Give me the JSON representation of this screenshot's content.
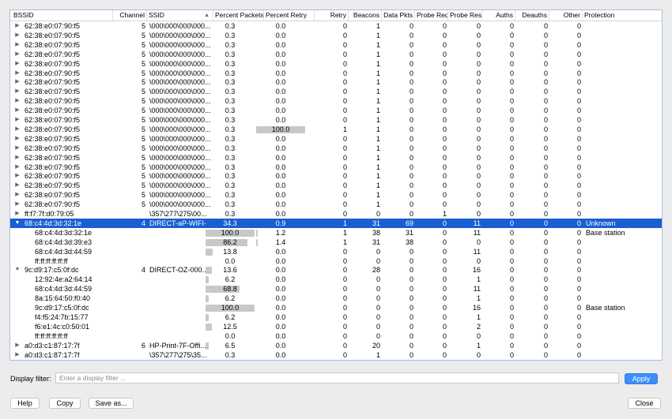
{
  "columns": [
    {
      "label": "BSSID"
    },
    {
      "label": "Channel"
    },
    {
      "label": "SSID"
    },
    {
      "label": "Percent Packets"
    },
    {
      "label": "Percent Retry"
    },
    {
      "label": "Retry"
    },
    {
      "label": "Beacons"
    },
    {
      "label": "Data Pkts"
    },
    {
      "label": "Probe Reqs"
    },
    {
      "label": "Probe Resp"
    },
    {
      "label": "Auths"
    },
    {
      "label": "Deauths"
    },
    {
      "label": "Other"
    },
    {
      "label": "Protection"
    }
  ],
  "sort_indicator": "▲",
  "rows": [
    {
      "level": 0,
      "expander": "closed",
      "bssid": "62:38:e0:07:90:f5",
      "channel": "5",
      "ssid": "\\000\\000\\000\\000...",
      "pct_packets": "0.3",
      "pct_packets_frac": 0,
      "pct_retry": "0.0",
      "pct_retry_frac": 0,
      "retry": "0",
      "beacons": "1",
      "data": "0",
      "probe_req": "0",
      "probe_resp": "0",
      "auths": "0",
      "deauths": "0",
      "other": "0",
      "protection": ""
    },
    {
      "level": 0,
      "expander": "closed",
      "bssid": "62:38:e0:07:90:f5",
      "channel": "5",
      "ssid": "\\000\\000\\000\\000...",
      "pct_packets": "0.3",
      "pct_packets_frac": 0,
      "pct_retry": "0.0",
      "pct_retry_frac": 0,
      "retry": "0",
      "beacons": "1",
      "data": "0",
      "probe_req": "0",
      "probe_resp": "0",
      "auths": "0",
      "deauths": "0",
      "other": "0",
      "protection": ""
    },
    {
      "level": 0,
      "expander": "closed",
      "bssid": "62:38:e0:07:90:f5",
      "channel": "5",
      "ssid": "\\000\\000\\000\\000...",
      "pct_packets": "0.3",
      "pct_packets_frac": 0,
      "pct_retry": "0.0",
      "pct_retry_frac": 0,
      "retry": "0",
      "beacons": "1",
      "data": "0",
      "probe_req": "0",
      "probe_resp": "0",
      "auths": "0",
      "deauths": "0",
      "other": "0",
      "protection": ""
    },
    {
      "level": 0,
      "expander": "closed",
      "bssid": "62:38:e0:07:90:f5",
      "channel": "5",
      "ssid": "\\000\\000\\000\\000...",
      "pct_packets": "0.3",
      "pct_packets_frac": 0,
      "pct_retry": "0.0",
      "pct_retry_frac": 0,
      "retry": "0",
      "beacons": "1",
      "data": "0",
      "probe_req": "0",
      "probe_resp": "0",
      "auths": "0",
      "deauths": "0",
      "other": "0",
      "protection": ""
    },
    {
      "level": 0,
      "expander": "closed",
      "bssid": "62:38:e0:07:90:f5",
      "channel": "5",
      "ssid": "\\000\\000\\000\\000...",
      "pct_packets": "0.3",
      "pct_packets_frac": 0,
      "pct_retry": "0.0",
      "pct_retry_frac": 0,
      "retry": "0",
      "beacons": "1",
      "data": "0",
      "probe_req": "0",
      "probe_resp": "0",
      "auths": "0",
      "deauths": "0",
      "other": "0",
      "protection": ""
    },
    {
      "level": 0,
      "expander": "closed",
      "bssid": "62:38:e0:07:90:f5",
      "channel": "5",
      "ssid": "\\000\\000\\000\\000...",
      "pct_packets": "0.3",
      "pct_packets_frac": 0,
      "pct_retry": "0.0",
      "pct_retry_frac": 0,
      "retry": "0",
      "beacons": "1",
      "data": "0",
      "probe_req": "0",
      "probe_resp": "0",
      "auths": "0",
      "deauths": "0",
      "other": "0",
      "protection": ""
    },
    {
      "level": 0,
      "expander": "closed",
      "bssid": "62:38:e0:07:90:f5",
      "channel": "5",
      "ssid": "\\000\\000\\000\\000...",
      "pct_packets": "0.3",
      "pct_packets_frac": 0,
      "pct_retry": "0.0",
      "pct_retry_frac": 0,
      "retry": "0",
      "beacons": "1",
      "data": "0",
      "probe_req": "0",
      "probe_resp": "0",
      "auths": "0",
      "deauths": "0",
      "other": "0",
      "protection": ""
    },
    {
      "level": 0,
      "expander": "closed",
      "bssid": "62:38:e0:07:90:f5",
      "channel": "5",
      "ssid": "\\000\\000\\000\\000...",
      "pct_packets": "0.3",
      "pct_packets_frac": 0,
      "pct_retry": "0.0",
      "pct_retry_frac": 0,
      "retry": "0",
      "beacons": "1",
      "data": "0",
      "probe_req": "0",
      "probe_resp": "0",
      "auths": "0",
      "deauths": "0",
      "other": "0",
      "protection": ""
    },
    {
      "level": 0,
      "expander": "closed",
      "bssid": "62:38:e0:07:90:f5",
      "channel": "5",
      "ssid": "\\000\\000\\000\\000...",
      "pct_packets": "0.3",
      "pct_packets_frac": 0,
      "pct_retry": "0.0",
      "pct_retry_frac": 0,
      "retry": "0",
      "beacons": "1",
      "data": "0",
      "probe_req": "0",
      "probe_resp": "0",
      "auths": "0",
      "deauths": "0",
      "other": "0",
      "protection": ""
    },
    {
      "level": 0,
      "expander": "closed",
      "bssid": "62:38:e0:07:90:f5",
      "channel": "5",
      "ssid": "\\000\\000\\000\\000...",
      "pct_packets": "0.3",
      "pct_packets_frac": 0,
      "pct_retry": "0.0",
      "pct_retry_frac": 0,
      "retry": "0",
      "beacons": "1",
      "data": "0",
      "probe_req": "0",
      "probe_resp": "0",
      "auths": "0",
      "deauths": "0",
      "other": "0",
      "protection": ""
    },
    {
      "level": 0,
      "expander": "closed",
      "bssid": "62:38:e0:07:90:f5",
      "channel": "5",
      "ssid": "\\000\\000\\000\\000...",
      "pct_packets": "0.3",
      "pct_packets_frac": 0,
      "pct_retry": "0.0",
      "pct_retry_frac": 0,
      "retry": "0",
      "beacons": "1",
      "data": "0",
      "probe_req": "0",
      "probe_resp": "0",
      "auths": "0",
      "deauths": "0",
      "other": "0",
      "protection": ""
    },
    {
      "level": 0,
      "expander": "closed",
      "bssid": "62:38:e0:07:90:f5",
      "channel": "5",
      "ssid": "\\000\\000\\000\\000...",
      "pct_packets": "0.3",
      "pct_packets_frac": 0,
      "pct_retry": "100.0",
      "pct_retry_frac": 1,
      "retry": "1",
      "beacons": "1",
      "data": "0",
      "probe_req": "0",
      "probe_resp": "0",
      "auths": "0",
      "deauths": "0",
      "other": "0",
      "protection": ""
    },
    {
      "level": 0,
      "expander": "closed",
      "bssid": "62:38:e0:07:90:f5",
      "channel": "5",
      "ssid": "\\000\\000\\000\\000...",
      "pct_packets": "0.3",
      "pct_packets_frac": 0,
      "pct_retry": "0.0",
      "pct_retry_frac": 0,
      "retry": "0",
      "beacons": "1",
      "data": "0",
      "probe_req": "0",
      "probe_resp": "0",
      "auths": "0",
      "deauths": "0",
      "other": "0",
      "protection": ""
    },
    {
      "level": 0,
      "expander": "closed",
      "bssid": "62:38:e0:07:90:f5",
      "channel": "5",
      "ssid": "\\000\\000\\000\\000...",
      "pct_packets": "0.3",
      "pct_packets_frac": 0,
      "pct_retry": "0.0",
      "pct_retry_frac": 0,
      "retry": "0",
      "beacons": "1",
      "data": "0",
      "probe_req": "0",
      "probe_resp": "0",
      "auths": "0",
      "deauths": "0",
      "other": "0",
      "protection": ""
    },
    {
      "level": 0,
      "expander": "closed",
      "bssid": "62:38:e0:07:90:f5",
      "channel": "5",
      "ssid": "\\000\\000\\000\\000...",
      "pct_packets": "0.3",
      "pct_packets_frac": 0,
      "pct_retry": "0.0",
      "pct_retry_frac": 0,
      "retry": "0",
      "beacons": "1",
      "data": "0",
      "probe_req": "0",
      "probe_resp": "0",
      "auths": "0",
      "deauths": "0",
      "other": "0",
      "protection": ""
    },
    {
      "level": 0,
      "expander": "closed",
      "bssid": "62:38:e0:07:90:f5",
      "channel": "5",
      "ssid": "\\000\\000\\000\\000...",
      "pct_packets": "0.3",
      "pct_packets_frac": 0,
      "pct_retry": "0.0",
      "pct_retry_frac": 0,
      "retry": "0",
      "beacons": "1",
      "data": "0",
      "probe_req": "0",
      "probe_resp": "0",
      "auths": "0",
      "deauths": "0",
      "other": "0",
      "protection": ""
    },
    {
      "level": 0,
      "expander": "closed",
      "bssid": "62:38:e0:07:90:f5",
      "channel": "5",
      "ssid": "\\000\\000\\000\\000...",
      "pct_packets": "0.3",
      "pct_packets_frac": 0,
      "pct_retry": "0.0",
      "pct_retry_frac": 0,
      "retry": "0",
      "beacons": "1",
      "data": "0",
      "probe_req": "0",
      "probe_resp": "0",
      "auths": "0",
      "deauths": "0",
      "other": "0",
      "protection": ""
    },
    {
      "level": 0,
      "expander": "closed",
      "bssid": "62:38:e0:07:90:f5",
      "channel": "5",
      "ssid": "\\000\\000\\000\\000...",
      "pct_packets": "0.3",
      "pct_packets_frac": 0,
      "pct_retry": "0.0",
      "pct_retry_frac": 0,
      "retry": "0",
      "beacons": "1",
      "data": "0",
      "probe_req": "0",
      "probe_resp": "0",
      "auths": "0",
      "deauths": "0",
      "other": "0",
      "protection": ""
    },
    {
      "level": 0,
      "expander": "closed",
      "bssid": "62:38:e0:07:90:f5",
      "channel": "5",
      "ssid": "\\000\\000\\000\\000...",
      "pct_packets": "0.3",
      "pct_packets_frac": 0,
      "pct_retry": "0.0",
      "pct_retry_frac": 0,
      "retry": "0",
      "beacons": "1",
      "data": "0",
      "probe_req": "0",
      "probe_resp": "0",
      "auths": "0",
      "deauths": "0",
      "other": "0",
      "protection": ""
    },
    {
      "level": 0,
      "expander": "closed",
      "bssid": "62:38:e0:07:90:f5",
      "channel": "5",
      "ssid": "\\000\\000\\000\\000...",
      "pct_packets": "0.3",
      "pct_packets_frac": 0,
      "pct_retry": "0.0",
      "pct_retry_frac": 0,
      "retry": "0",
      "beacons": "1",
      "data": "0",
      "probe_req": "0",
      "probe_resp": "0",
      "auths": "0",
      "deauths": "0",
      "other": "0",
      "protection": ""
    },
    {
      "level": 0,
      "expander": "closed",
      "bssid": "ff:f7:7f:d0:79:05",
      "channel": "",
      "ssid": "\\357\\277\\275\\00...",
      "pct_packets": "0.3",
      "pct_packets_frac": 0,
      "pct_retry": "0.0",
      "pct_retry_frac": 0,
      "retry": "0",
      "beacons": "0",
      "data": "0",
      "probe_req": "1",
      "probe_resp": "0",
      "auths": "0",
      "deauths": "0",
      "other": "0",
      "protection": ""
    },
    {
      "level": 0,
      "expander": "open",
      "selected": true,
      "bssid": "68:c4:4d:3d:32:1e",
      "channel": "4",
      "ssid": "DIRECT-aP-WIFI-...",
      "pct_packets": "34.3",
      "pct_packets_frac": 0.343,
      "pct_retry": "0.9",
      "pct_retry_frac": 0.009,
      "retry": "1",
      "beacons": "31",
      "data": "69",
      "probe_req": "0",
      "probe_resp": "11",
      "auths": "0",
      "deauths": "0",
      "other": "0",
      "protection": "Unknown"
    },
    {
      "level": 1,
      "expander": "",
      "bssid": "68:c4:4d:3d:32:1e",
      "channel": "",
      "ssid": "",
      "pct_packets": "100.0",
      "pct_packets_frac": 1,
      "pct_retry": "1.2",
      "pct_retry_frac": 0.012,
      "retry": "1",
      "beacons": "38",
      "data": "31",
      "probe_req": "0",
      "probe_resp": "11",
      "auths": "0",
      "deauths": "0",
      "other": "0",
      "protection": "Base station"
    },
    {
      "level": 1,
      "expander": "",
      "bssid": "68:c4:4d:3d:39:e3",
      "channel": "",
      "ssid": "",
      "pct_packets": "86.2",
      "pct_packets_frac": 0.862,
      "pct_retry": "1.4",
      "pct_retry_frac": 0.014,
      "retry": "1",
      "beacons": "31",
      "data": "38",
      "probe_req": "0",
      "probe_resp": "0",
      "auths": "0",
      "deauths": "0",
      "other": "0",
      "protection": ""
    },
    {
      "level": 1,
      "expander": "",
      "bssid": "68:c4:4d:3d:44:59",
      "channel": "",
      "ssid": "",
      "pct_packets": "13.8",
      "pct_packets_frac": 0.138,
      "pct_retry": "0.0",
      "pct_retry_frac": 0,
      "retry": "0",
      "beacons": "0",
      "data": "0",
      "probe_req": "0",
      "probe_resp": "11",
      "auths": "0",
      "deauths": "0",
      "other": "0",
      "protection": ""
    },
    {
      "level": 1,
      "expander": "",
      "bssid": "ff:ff:ff:ff:ff:ff",
      "channel": "",
      "ssid": "",
      "pct_packets": "0.0",
      "pct_packets_frac": 0,
      "pct_retry": "0.0",
      "pct_retry_frac": 0,
      "retry": "0",
      "beacons": "0",
      "data": "0",
      "probe_req": "0",
      "probe_resp": "0",
      "auths": "0",
      "deauths": "0",
      "other": "0",
      "protection": ""
    },
    {
      "level": 0,
      "expander": "open",
      "bssid": "9c:d9:17:c5:0f:dc",
      "channel": "4",
      "ssid": "DIRECT-OZ-000...",
      "pct_packets": "13.6",
      "pct_packets_frac": 0.136,
      "pct_retry": "0.0",
      "pct_retry_frac": 0,
      "retry": "0",
      "beacons": "28",
      "data": "0",
      "probe_req": "0",
      "probe_resp": "16",
      "auths": "0",
      "deauths": "0",
      "other": "0",
      "protection": ""
    },
    {
      "level": 1,
      "expander": "",
      "bssid": "12:92:4e:a2:64:14",
      "channel": "",
      "ssid": "",
      "pct_packets": "6.2",
      "pct_packets_frac": 0.062,
      "pct_retry": "0.0",
      "pct_retry_frac": 0,
      "retry": "0",
      "beacons": "0",
      "data": "0",
      "probe_req": "0",
      "probe_resp": "1",
      "auths": "0",
      "deauths": "0",
      "other": "0",
      "protection": ""
    },
    {
      "level": 1,
      "expander": "",
      "bssid": "68:c4:4d:3d:44:59",
      "channel": "",
      "ssid": "",
      "pct_packets": "68.8",
      "pct_packets_frac": 0.688,
      "pct_retry": "0.0",
      "pct_retry_frac": 0,
      "retry": "0",
      "beacons": "0",
      "data": "0",
      "probe_req": "0",
      "probe_resp": "11",
      "auths": "0",
      "deauths": "0",
      "other": "0",
      "protection": ""
    },
    {
      "level": 1,
      "expander": "",
      "bssid": "8a:15:64:50:f0:40",
      "channel": "",
      "ssid": "",
      "pct_packets": "6.2",
      "pct_packets_frac": 0.062,
      "pct_retry": "0.0",
      "pct_retry_frac": 0,
      "retry": "0",
      "beacons": "0",
      "data": "0",
      "probe_req": "0",
      "probe_resp": "1",
      "auths": "0",
      "deauths": "0",
      "other": "0",
      "protection": ""
    },
    {
      "level": 1,
      "expander": "",
      "bssid": "9c:d9:17:c5:0f:dc",
      "channel": "",
      "ssid": "",
      "pct_packets": "100.0",
      "pct_packets_frac": 1,
      "pct_retry": "0.0",
      "pct_retry_frac": 0,
      "retry": "0",
      "beacons": "0",
      "data": "0",
      "probe_req": "0",
      "probe_resp": "16",
      "auths": "0",
      "deauths": "0",
      "other": "0",
      "protection": "Base station"
    },
    {
      "level": 1,
      "expander": "",
      "bssid": "f4:f5:24:7b:15:77",
      "channel": "",
      "ssid": "",
      "pct_packets": "6.2",
      "pct_packets_frac": 0.062,
      "pct_retry": "0.0",
      "pct_retry_frac": 0,
      "retry": "0",
      "beacons": "0",
      "data": "0",
      "probe_req": "0",
      "probe_resp": "1",
      "auths": "0",
      "deauths": "0",
      "other": "0",
      "protection": ""
    },
    {
      "level": 1,
      "expander": "",
      "bssid": "f6:e1:4c:c0:50:01",
      "channel": "",
      "ssid": "",
      "pct_packets": "12.5",
      "pct_packets_frac": 0.125,
      "pct_retry": "0.0",
      "pct_retry_frac": 0,
      "retry": "0",
      "beacons": "0",
      "data": "0",
      "probe_req": "0",
      "probe_resp": "2",
      "auths": "0",
      "deauths": "0",
      "other": "0",
      "protection": ""
    },
    {
      "level": 1,
      "expander": "",
      "bssid": "ff:ff:ff:ff:ff:ff",
      "channel": "",
      "ssid": "",
      "pct_packets": "0.0",
      "pct_packets_frac": 0,
      "pct_retry": "0.0",
      "pct_retry_frac": 0,
      "retry": "0",
      "beacons": "0",
      "data": "0",
      "probe_req": "0",
      "probe_resp": "0",
      "auths": "0",
      "deauths": "0",
      "other": "0",
      "protection": ""
    },
    {
      "level": 0,
      "expander": "closed",
      "bssid": "a0:d3:c1:87:17:7f",
      "channel": "6",
      "ssid": "HP-Print-7F-Offi...",
      "pct_packets": "6.5",
      "pct_packets_frac": 0.065,
      "pct_retry": "0.0",
      "pct_retry_frac": 0,
      "retry": "0",
      "beacons": "20",
      "data": "0",
      "probe_req": "0",
      "probe_resp": "1",
      "auths": "0",
      "deauths": "0",
      "other": "0",
      "protection": ""
    },
    {
      "level": 0,
      "expander": "closed",
      "bssid": "a0:d3:c1:87:17:7f",
      "channel": "",
      "ssid": "\\357\\277\\275\\35...",
      "pct_packets": "0.3",
      "pct_packets_frac": 0,
      "pct_retry": "0.0",
      "pct_retry_frac": 0,
      "retry": "0",
      "beacons": "1",
      "data": "0",
      "probe_req": "0",
      "probe_resp": "0",
      "auths": "0",
      "deauths": "0",
      "other": "0",
      "protection": ""
    }
  ],
  "filter": {
    "label": "Display filter:",
    "placeholder": "Enter a display filter ...",
    "value": ""
  },
  "buttons": {
    "apply": "Apply",
    "help": "Help",
    "copy": "Copy",
    "save_as": "Save as...",
    "close": "Close"
  },
  "colors": {
    "selection": "#1a5fd1",
    "bar": "#c8c8c8",
    "primary_button": "#3d8ef8"
  }
}
